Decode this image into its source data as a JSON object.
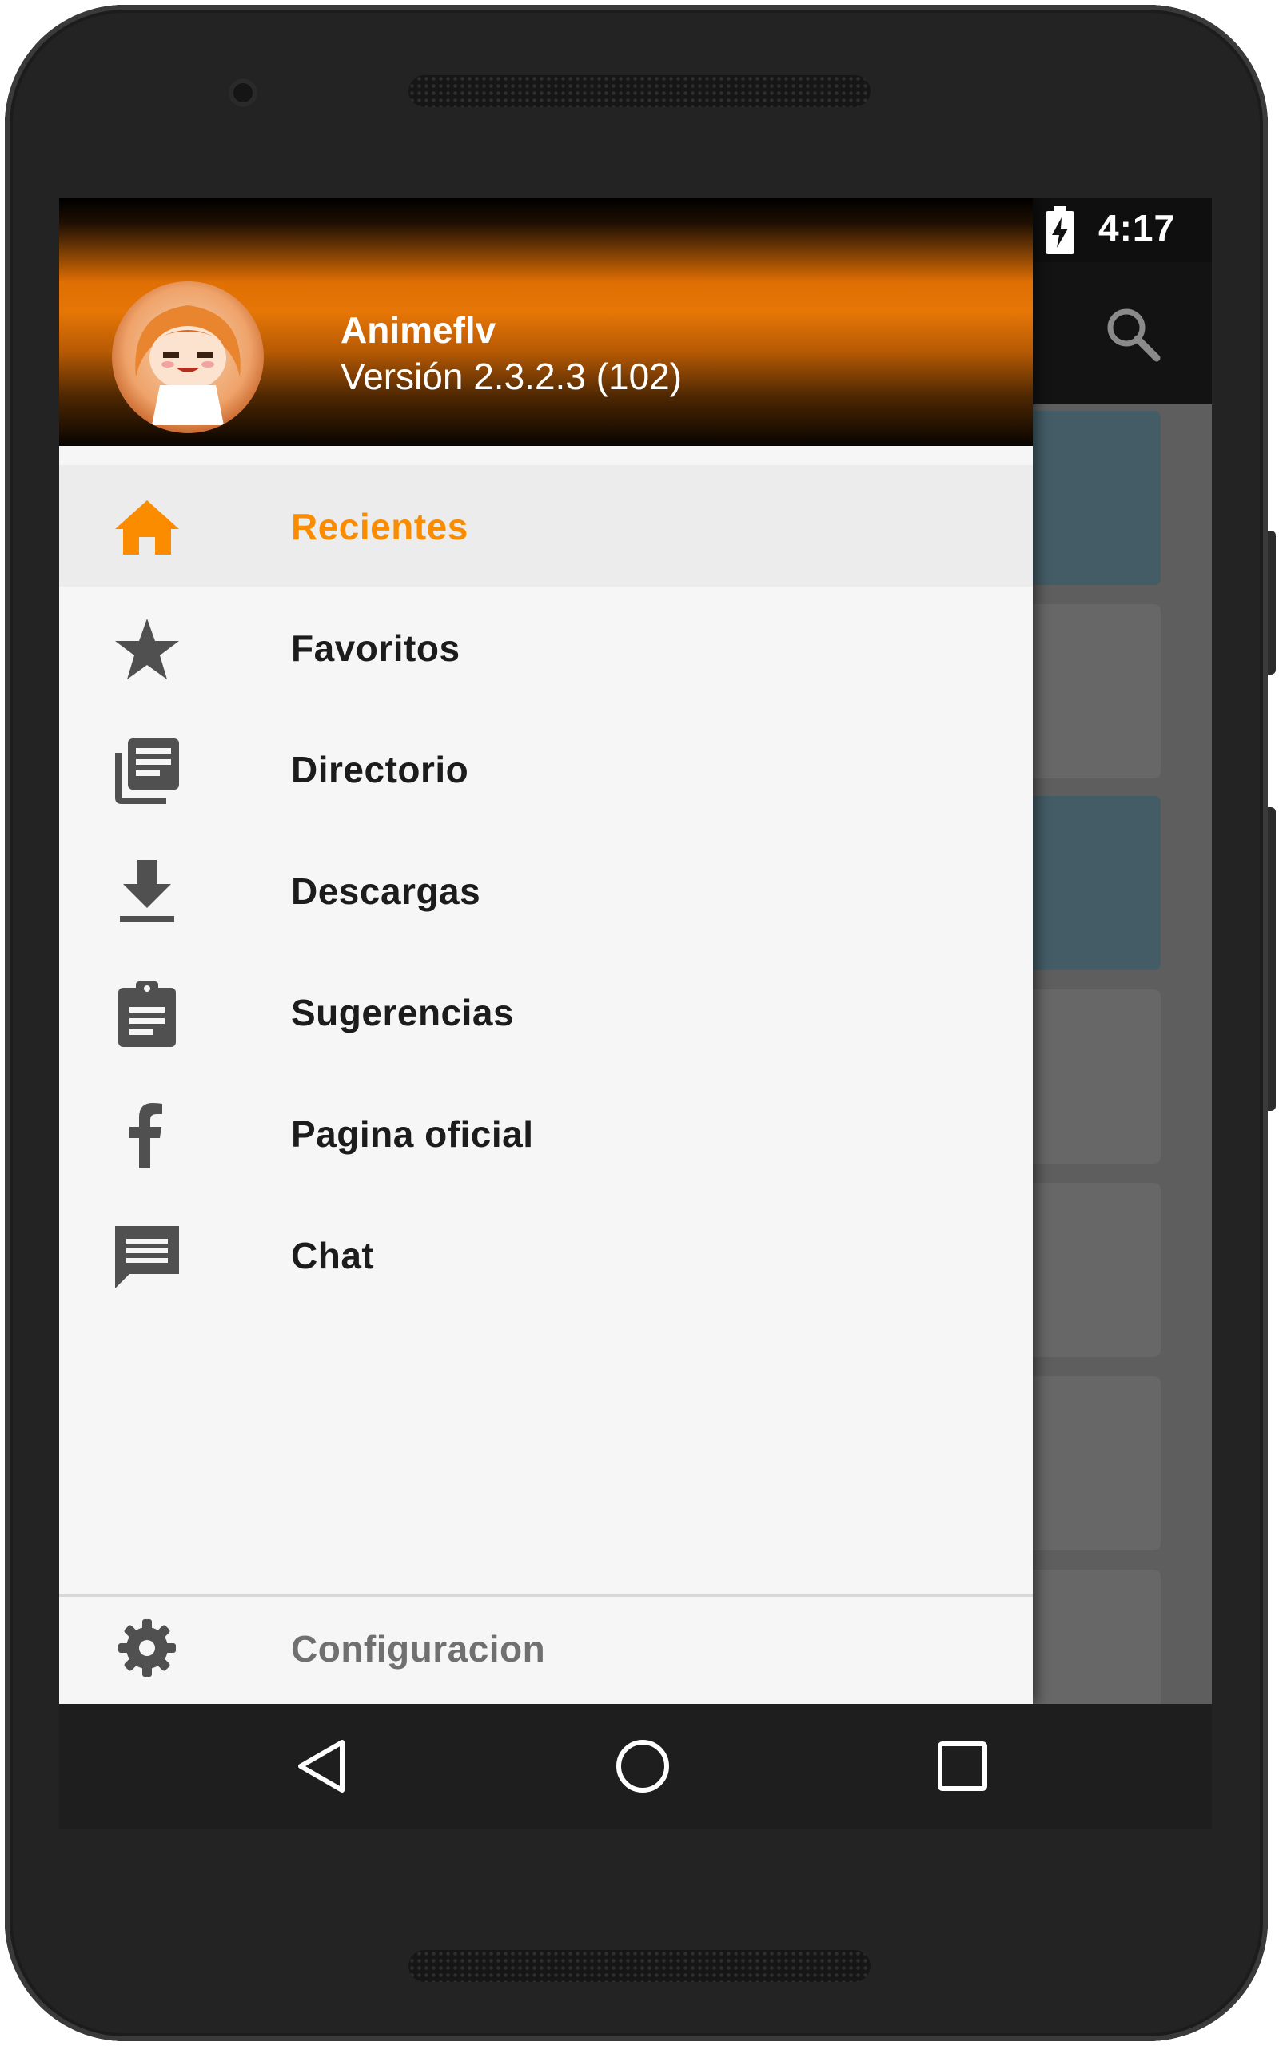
{
  "status_bar": {
    "time": "4:17"
  },
  "drawer": {
    "header": {
      "app_name": "Animeflv",
      "version": "Versión 2.3.2.3 (102)"
    },
    "items": [
      {
        "label": "Recientes",
        "icon": "home-icon",
        "active": true
      },
      {
        "label": "Favoritos",
        "icon": "star-icon",
        "active": false
      },
      {
        "label": "Directorio",
        "icon": "library-books-icon",
        "active": false
      },
      {
        "label": "Descargas",
        "icon": "download-icon",
        "active": false
      },
      {
        "label": "Sugerencias",
        "icon": "assignment-icon",
        "active": false
      },
      {
        "label": "Pagina oficial",
        "icon": "facebook-icon",
        "active": false
      },
      {
        "label": "Chat",
        "icon": "chat-icon",
        "active": false
      }
    ],
    "footer": {
      "label": "Configuracion",
      "icon": "gear-icon"
    }
  },
  "colors": {
    "accent": "#fb8c00",
    "card_teal": "#435c66",
    "card_gray": "#666666"
  },
  "navigation_bar": {
    "buttons": [
      "back-icon",
      "home-circle-icon",
      "recents-icon"
    ]
  }
}
